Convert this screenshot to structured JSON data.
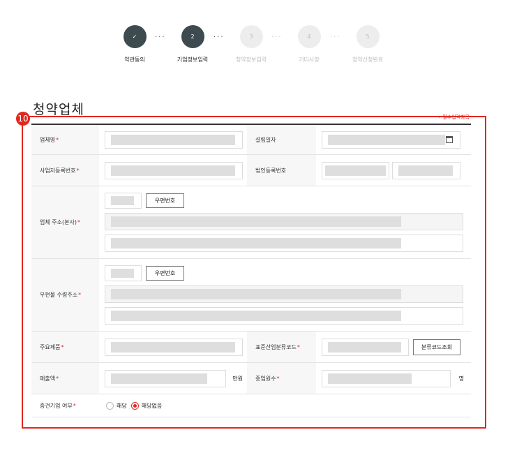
{
  "stepper": {
    "steps": [
      {
        "num": "✓",
        "label": "약관동의",
        "state": "done"
      },
      {
        "num": "2",
        "label": "기업정보입력",
        "state": "active"
      },
      {
        "num": "3",
        "label": "청약정보입력",
        "state": "todo"
      },
      {
        "num": "4",
        "label": "기타사항",
        "state": "todo"
      },
      {
        "num": "5",
        "label": "청약신청완료",
        "state": "todo"
      }
    ],
    "dots": "···"
  },
  "section": {
    "title": "청약업체",
    "required_note": "• 필수입력항목",
    "badge": "10"
  },
  "form": {
    "company_name_label": "업체명",
    "established_label": "설립일자",
    "biz_reg_label": "사업자등록번호",
    "corp_reg_label": "법인등록번호",
    "address_label": "업체 주소(본사)",
    "zipcode_button": "우편번호",
    "mail_address_label": "우편물 수령주소",
    "zipcode_button2": "우편번호",
    "main_product_label": "주요제품",
    "industry_code_label": "표준산업분류코드",
    "industry_code_button": "분류코드조회",
    "sales_label": "매출액",
    "sales_unit": "만원",
    "employees_label": "종업원수",
    "employees_unit": "명",
    "midsize_label": "중견기업 여부",
    "radio_yes": "해당",
    "radio_no": "해당없음",
    "required_mark": "*"
  },
  "colors": {
    "accent": "#e2271f",
    "step_active": "#3d4a4f"
  }
}
